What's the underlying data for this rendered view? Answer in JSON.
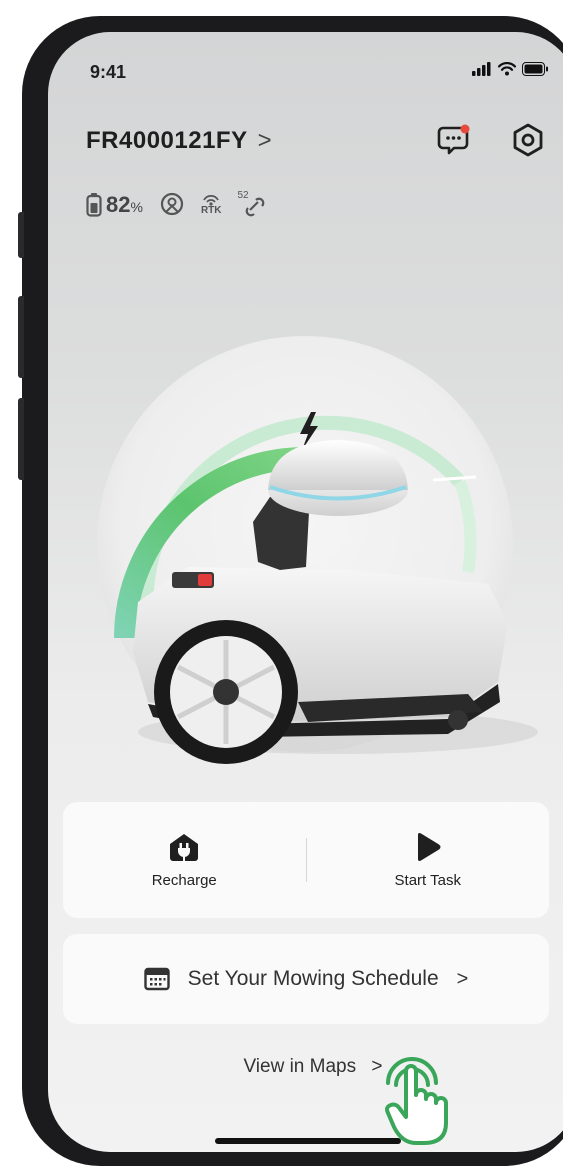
{
  "status_bar": {
    "time": "9:41"
  },
  "device": {
    "name": "FR4000121FY",
    "chevron": ">"
  },
  "status": {
    "battery_value": "82",
    "battery_unit": "%",
    "satellite_label": "RTK",
    "satellite_count": "52"
  },
  "icons": {
    "messages": "chat-bubble-icon",
    "settings": "gear-icon",
    "battery": "battery-icon",
    "location": "location-pin-icon",
    "rtk": "rtk-signal-icon",
    "link": "satellite-link-icon",
    "charging": "lightning-icon",
    "recharge": "home-plug-icon",
    "start": "play-icon",
    "calendar": "calendar-icon"
  },
  "gauge": {
    "level_percent": 82,
    "accent_color": "#5cc46e"
  },
  "actions": {
    "recharge_label": "Recharge",
    "start_label": "Start Task"
  },
  "schedule": {
    "label": "Set Your Mowing Schedule",
    "chevron": ">"
  },
  "maps": {
    "label": "View in Maps",
    "chevron": ">"
  },
  "colors": {
    "accent": "#5cc46e",
    "notify": "#e8493d",
    "hand": "#3aa65a"
  }
}
